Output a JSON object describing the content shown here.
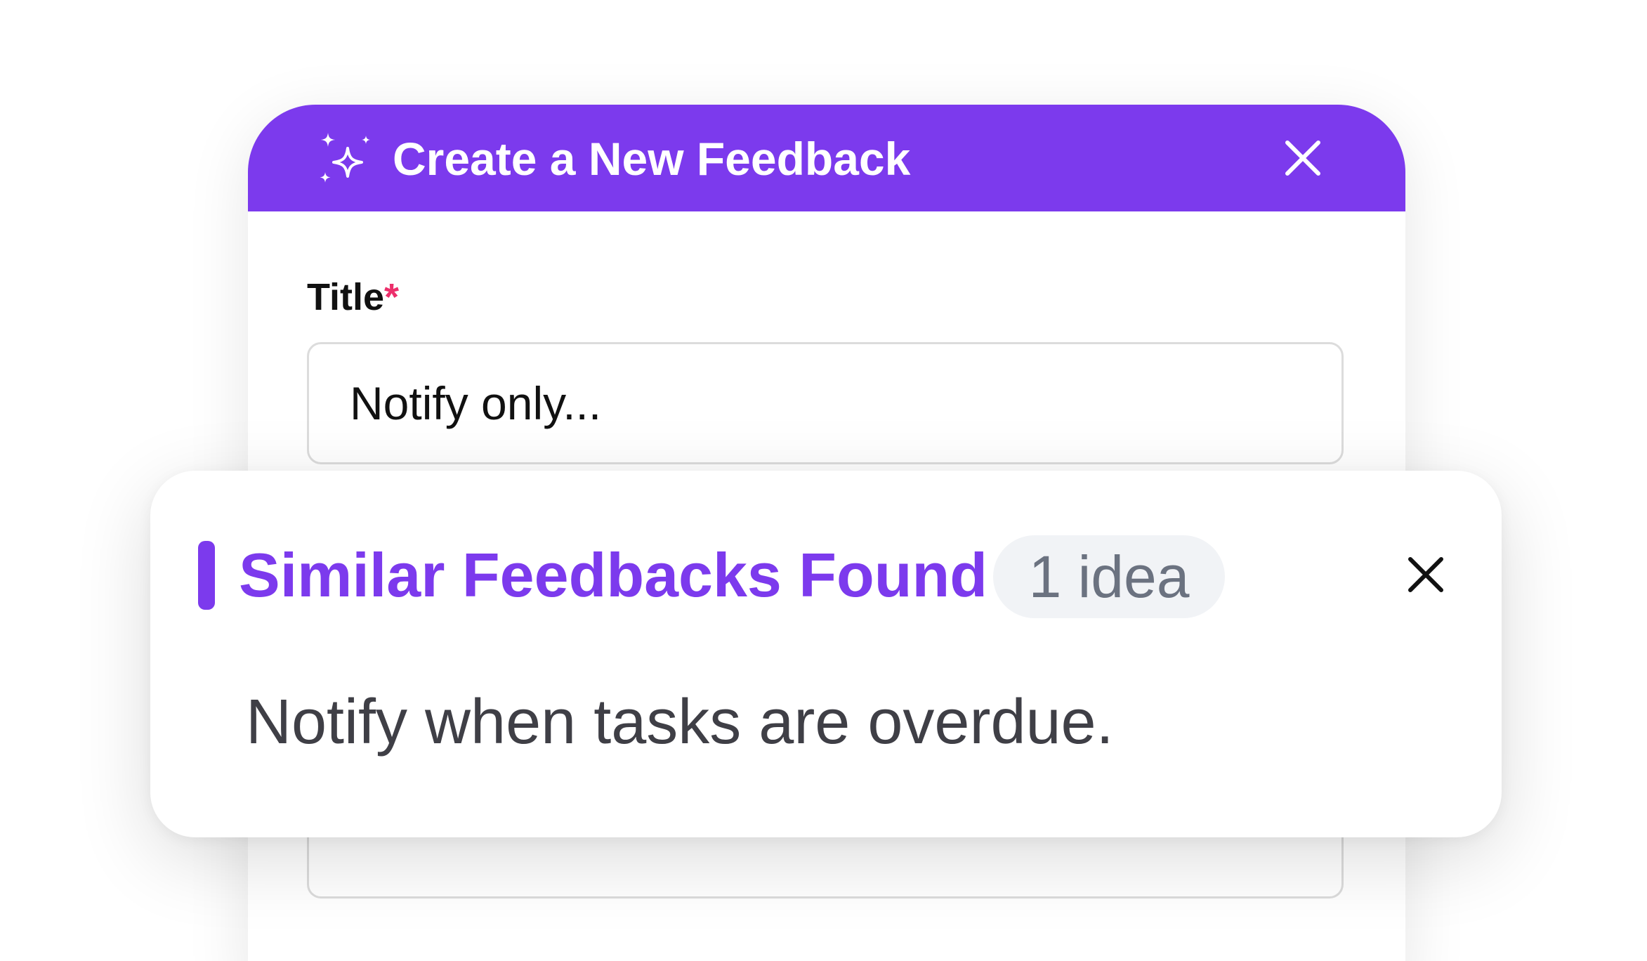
{
  "modal": {
    "title": "Create a New Feedback",
    "header_icon": "sparkle-icon",
    "close_icon": "close-icon",
    "field_title_label": "Title",
    "field_title_required": "*",
    "field_title_value": "Notify only..."
  },
  "similar": {
    "heading": "Similar Feedbacks Found",
    "count_badge": "1 idea",
    "close_icon": "close-icon",
    "items": [
      {
        "text": "Notify when tasks are overdue."
      }
    ]
  },
  "colors": {
    "accent": "#7c3aed",
    "required": "#ec2f6b",
    "badge_bg": "#f1f3f6",
    "badge_text": "#6b7280"
  }
}
